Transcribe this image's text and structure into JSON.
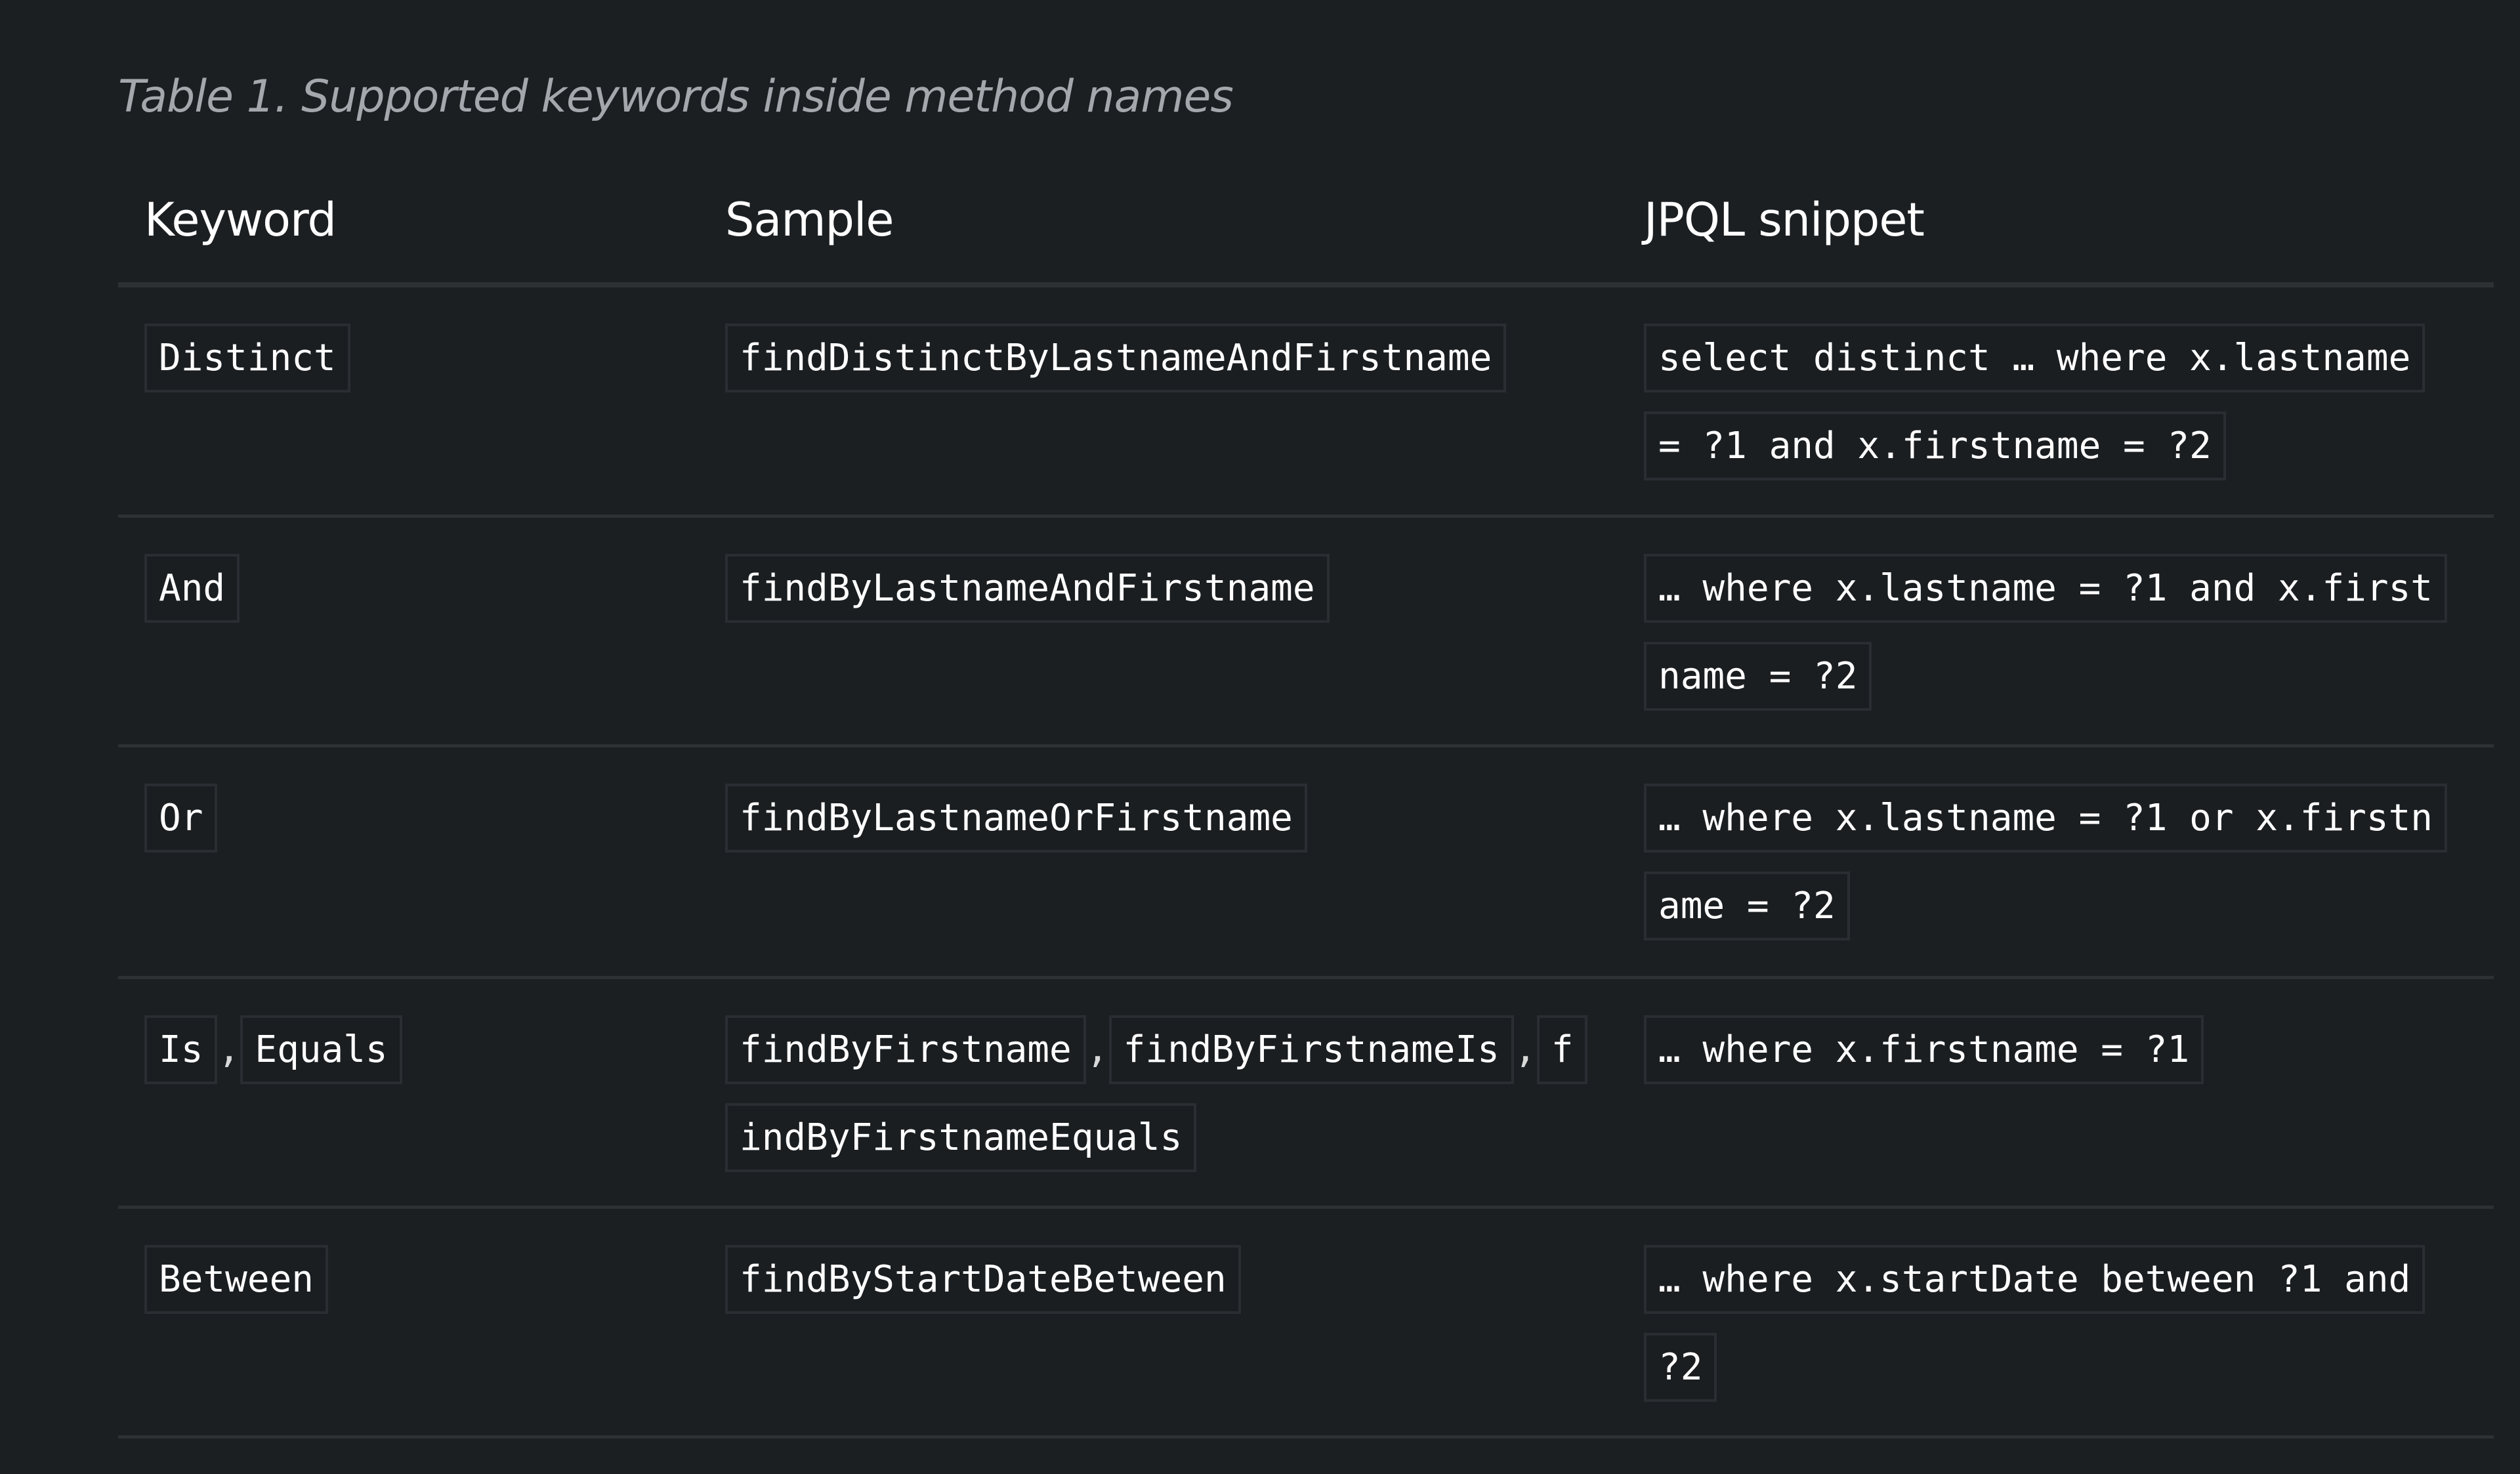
{
  "caption": "Table 1. Supported keywords inside method names",
  "table": {
    "headers": [
      "Keyword",
      "Sample",
      "JPQL snippet"
    ],
    "rows": [
      {
        "keywords": [
          "Distinct"
        ],
        "samples": [
          "findDistinctByLastnameAndFirstname"
        ],
        "jpql": "select distinct … where x.lastname = ?1 and x.firstname = ?2"
      },
      {
        "keywords": [
          "And"
        ],
        "samples": [
          "findByLastnameAndFirstname"
        ],
        "jpql": "… where x.lastname = ?1 and x.firstname = ?2"
      },
      {
        "keywords": [
          "Or"
        ],
        "samples": [
          "findByLastnameOrFirstname"
        ],
        "jpql": "… where x.lastname = ?1 or x.firstname = ?2"
      },
      {
        "keywords": [
          "Is",
          "Equals"
        ],
        "samples": [
          "findByFirstname",
          "findByFirstnameIs",
          "findByFirstnameEquals"
        ],
        "jpql": "… where x.firstname = ?1"
      },
      {
        "keywords": [
          "Between"
        ],
        "samples": [
          "findByStartDateBetween"
        ],
        "jpql": "… where x.startDate between ?1 and ?2"
      }
    ],
    "separator": ","
  }
}
